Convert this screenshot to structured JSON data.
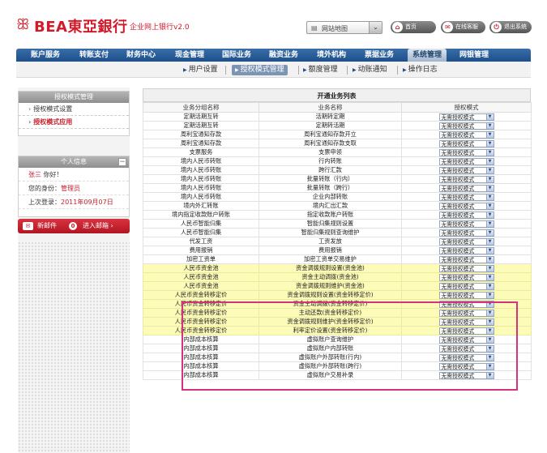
{
  "header": {
    "logo_mark": "ꕥ",
    "logo_text": "BEA東亞銀行",
    "logo_sub": "企业网上银行v2.0",
    "map_select": {
      "value": "网站地图",
      "arrow": "⌄"
    },
    "home_label": "首页",
    "contact_label": "在线客服",
    "logout_label": "退出系统",
    "home_icon": "⌂",
    "contact_icon": "✉",
    "logout_icon": "⏻"
  },
  "nav": {
    "items": [
      {
        "label": "账户服务"
      },
      {
        "label": "转账支付"
      },
      {
        "label": "财务中心"
      },
      {
        "label": "现金管理"
      },
      {
        "label": "国际业务"
      },
      {
        "label": "融资业务"
      },
      {
        "label": "境外机构"
      },
      {
        "label": "票据业务"
      },
      {
        "label": "系统管理"
      },
      {
        "label": "网银管理"
      }
    ]
  },
  "subnav": {
    "items": [
      {
        "label": "用户设置"
      },
      {
        "label": "授权模式管理"
      },
      {
        "label": "额度管理"
      },
      {
        "label": "动账通知"
      },
      {
        "label": "操作日志"
      }
    ]
  },
  "left": {
    "auth_title": "授权模式管理",
    "auth_items": [
      {
        "label": "授权模式设置"
      },
      {
        "label": "授权模式应用"
      }
    ],
    "info_title": "个人信息",
    "greeting_name": "张三",
    "greeting_text": " 你好！",
    "role_label": "您的身份：",
    "role_value": "管理员",
    "last_login_label": "上次登录：",
    "last_login_value": "2011年09月07日",
    "mail_label": "新邮件",
    "mail_count": "0",
    "mail_enter": "进入邮箱 ›"
  },
  "table": {
    "title": "开通业务列表",
    "headers": [
      "业务分组名称",
      "业务名称",
      "授权模式"
    ],
    "default_mode": "无需授权模式",
    "rows": [
      {
        "group": "定期活期互转",
        "name": "活期转定期"
      },
      {
        "group": "定期活期互转",
        "name": "定期转活期"
      },
      {
        "group": "周利宝通知存款",
        "name": "周利宝通知存款开立"
      },
      {
        "group": "周利宝通知存款",
        "name": "周利宝通知存款支取"
      },
      {
        "group": "支票服务",
        "name": "支票申领"
      },
      {
        "group": "境内人民币转账",
        "name": "行内转账"
      },
      {
        "group": "境内人民币转账",
        "name": "跨行汇款"
      },
      {
        "group": "境内人民币转账",
        "name": "批量转账（行内）"
      },
      {
        "group": "境内人民币转账",
        "name": "批量转账（跨行）"
      },
      {
        "group": "境内人民币转账",
        "name": "企业内部转账"
      },
      {
        "group": "境内外汇转账",
        "name": "境内汇出汇款"
      },
      {
        "group": "境内指定收款账户转账",
        "name": "指定收款账户转账"
      },
      {
        "group": "人民币智能归集",
        "name": "智能归集规则设置"
      },
      {
        "group": "人民币智能归集",
        "name": "智能归集规则查询维护"
      },
      {
        "group": "代发工资",
        "name": "工资发放"
      },
      {
        "group": "费用报销",
        "name": "费用报销"
      },
      {
        "group": "加密工资单",
        "name": "加密工资单交易维护"
      },
      {
        "group": "人民币资金池",
        "name": "资金调拨规则设置(资金池)"
      },
      {
        "group": "人民币资金池",
        "name": "资金主动调拨(资金池)"
      },
      {
        "group": "人民币资金池",
        "name": "资金调拨规则维护(资金池)"
      },
      {
        "group": "人民币资金转移定价",
        "name": "资金调拨规则设置(资金转移定价)"
      },
      {
        "group": "人民币资金转移定价",
        "name": "资金主动调拨(资金转移定价)"
      },
      {
        "group": "人民币资金转移定价",
        "name": "主动还款(资金转移定价)"
      },
      {
        "group": "人民币资金转移定价",
        "name": "资金调拨规则维护(资金转移定价)"
      },
      {
        "group": "人民币资金转移定价",
        "name": "利率定价设置(资金转移定价)"
      },
      {
        "group": "内部成本核算",
        "name": "虚拟账户查询维护"
      },
      {
        "group": "内部成本核算",
        "name": "虚拟账户内部转账"
      },
      {
        "group": "内部成本核算",
        "name": "虚拟账户外部转账(行内)"
      },
      {
        "group": "内部成本核算",
        "name": "虚拟账户外部转账(跨行)"
      },
      {
        "group": "内部成本核算",
        "name": "虚拟账户交易补录"
      }
    ],
    "highlight_rows": [
      17,
      18,
      19,
      20,
      21,
      22,
      23,
      24
    ]
  },
  "colors": {
    "brand_red": "#d11a2a",
    "nav_blue": "#1d4f8a",
    "highlight_yellow": "#fdfbb8",
    "highlight_border": "#d6337e"
  }
}
